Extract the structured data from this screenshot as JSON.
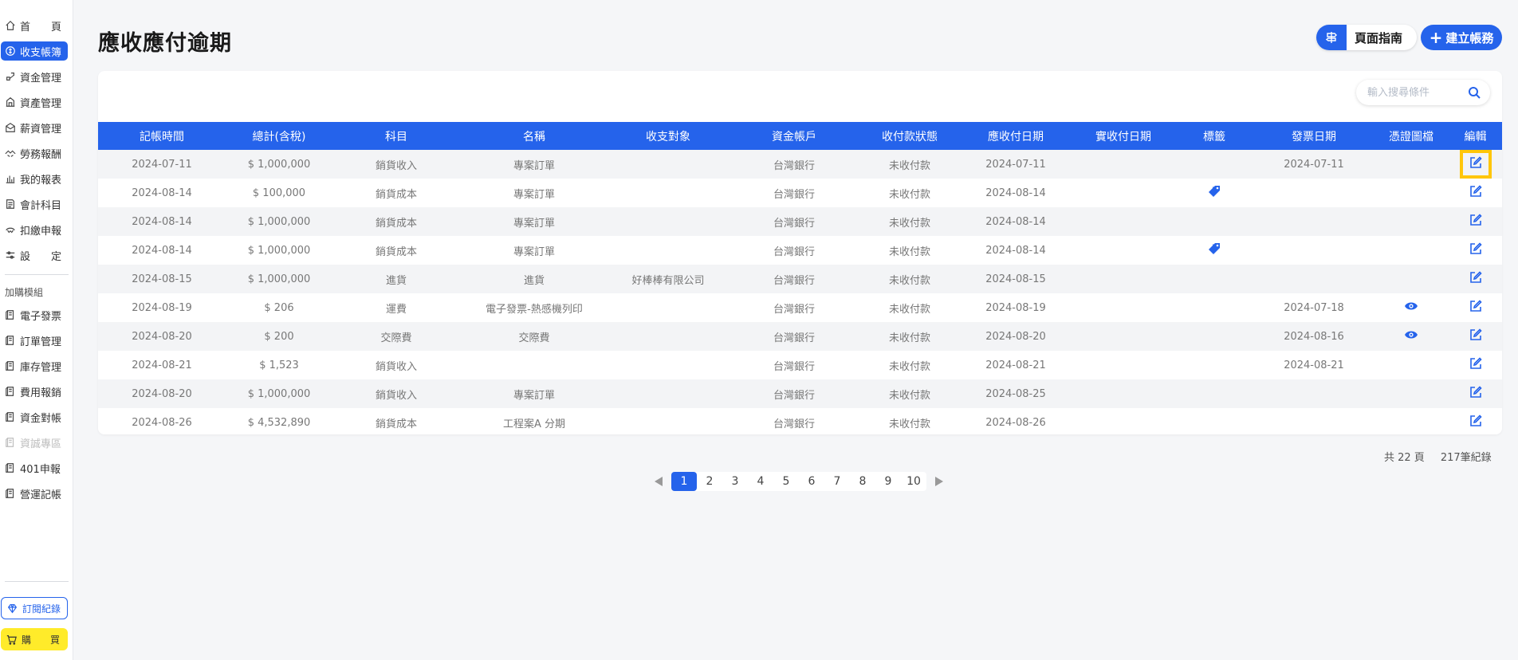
{
  "sidebar": {
    "items": [
      {
        "label": "首　　頁",
        "icon": "home-icon"
      },
      {
        "label": "收支帳簿",
        "icon": "coin-icon",
        "active": true
      },
      {
        "label": "資金管理",
        "icon": "money-bag-icon"
      },
      {
        "label": "資產管理",
        "icon": "building-icon"
      },
      {
        "label": "薪資管理",
        "icon": "envelope-icon"
      },
      {
        "label": "勞務報酬",
        "icon": "handshake-icon"
      },
      {
        "label": "我的報表",
        "icon": "bar-chart-icon"
      },
      {
        "label": "會計科目",
        "icon": "ledger-icon"
      },
      {
        "label": "扣繳申報",
        "icon": "hands-icon"
      },
      {
        "label": "設　　定",
        "icon": "sliders-icon"
      }
    ],
    "addon_label": "加購模組",
    "addon_items": [
      {
        "label": "電子發票",
        "disabled": false
      },
      {
        "label": "訂單管理",
        "disabled": false
      },
      {
        "label": "庫存管理",
        "disabled": false
      },
      {
        "label": "費用報銷",
        "disabled": false
      },
      {
        "label": "資金對帳",
        "disabled": false
      },
      {
        "label": "資誠專區",
        "disabled": true
      },
      {
        "label": "401申報",
        "disabled": false
      },
      {
        "label": "營運記帳",
        "disabled": false
      }
    ],
    "subscription_label": "訂閱紀錄",
    "buy_label": "購　　買"
  },
  "header": {
    "title": "應收應付逾期",
    "guide_label": "頁面指南",
    "create_label": "建立帳務"
  },
  "search": {
    "placeholder": "輸入搜尋條件"
  },
  "table": {
    "columns": [
      "記帳時間",
      "總計(含稅)",
      "科目",
      "名稱",
      "收支對象",
      "資金帳戶",
      "收付款狀態",
      "應收付日期",
      "實收付日期",
      "標籤",
      "發票日期",
      "憑證圖檔",
      "編輯"
    ],
    "rows": [
      {
        "date": "2024-07-11",
        "total": "$ 1,000,000",
        "subject": "銷貨收入",
        "name": "專案訂單",
        "party": "",
        "account": "台灣銀行",
        "status": "未收付款",
        "due": "2024-07-11",
        "actual": "",
        "tag": false,
        "invoice": "2024-07-11",
        "receipt": false,
        "highlight": true
      },
      {
        "date": "2024-08-14",
        "total": "$ 100,000",
        "subject": "銷貨成本",
        "name": "專案訂單",
        "party": "",
        "account": "台灣銀行",
        "status": "未收付款",
        "due": "2024-08-14",
        "actual": "",
        "tag": true,
        "invoice": "",
        "receipt": false,
        "highlight": false
      },
      {
        "date": "2024-08-14",
        "total": "$ 1,000,000",
        "subject": "銷貨成本",
        "name": "專案訂單",
        "party": "",
        "account": "台灣銀行",
        "status": "未收付款",
        "due": "2024-08-14",
        "actual": "",
        "tag": false,
        "invoice": "",
        "receipt": false,
        "highlight": false
      },
      {
        "date": "2024-08-14",
        "total": "$ 1,000,000",
        "subject": "銷貨成本",
        "name": "專案訂單",
        "party": "",
        "account": "台灣銀行",
        "status": "未收付款",
        "due": "2024-08-14",
        "actual": "",
        "tag": true,
        "invoice": "",
        "receipt": false,
        "highlight": false
      },
      {
        "date": "2024-08-15",
        "total": "$ 1,000,000",
        "subject": "進貨",
        "name": "進貨",
        "party": "好棒棒有限公司",
        "account": "台灣銀行",
        "status": "未收付款",
        "due": "2024-08-15",
        "actual": "",
        "tag": false,
        "invoice": "",
        "receipt": false,
        "highlight": false
      },
      {
        "date": "2024-08-19",
        "total": "$ 206",
        "subject": "運費",
        "name": "電子發票-熱感機列印",
        "party": "",
        "account": "台灣銀行",
        "status": "未收付款",
        "due": "2024-08-19",
        "actual": "",
        "tag": false,
        "invoice": "2024-07-18",
        "receipt": true,
        "highlight": false
      },
      {
        "date": "2024-08-20",
        "total": "$ 200",
        "subject": "交際費",
        "name": "交際費",
        "party": "",
        "account": "台灣銀行",
        "status": "未收付款",
        "due": "2024-08-20",
        "actual": "",
        "tag": false,
        "invoice": "2024-08-16",
        "receipt": true,
        "highlight": false
      },
      {
        "date": "2024-08-21",
        "total": "$ 1,523",
        "subject": "銷貨收入",
        "name": "",
        "party": "",
        "account": "台灣銀行",
        "status": "未收付款",
        "due": "2024-08-21",
        "actual": "",
        "tag": false,
        "invoice": "2024-08-21",
        "receipt": false,
        "highlight": false
      },
      {
        "date": "2024-08-20",
        "total": "$ 1,000,000",
        "subject": "銷貨收入",
        "name": "專案訂單",
        "party": "",
        "account": "台灣銀行",
        "status": "未收付款",
        "due": "2024-08-25",
        "actual": "",
        "tag": false,
        "invoice": "",
        "receipt": false,
        "highlight": false
      },
      {
        "date": "2024-08-26",
        "total": "$ 4,532,890",
        "subject": "銷貨成本",
        "name": "工程案A 分期",
        "party": "",
        "account": "台灣銀行",
        "status": "未收付款",
        "due": "2024-08-26",
        "actual": "",
        "tag": false,
        "invoice": "",
        "receipt": false,
        "highlight": false
      }
    ]
  },
  "summary": {
    "pages_text": "共 22 頁",
    "records_text": "217筆紀錄"
  },
  "pagination": {
    "pages": [
      "1",
      "2",
      "3",
      "4",
      "5",
      "6",
      "7",
      "8",
      "9",
      "10"
    ],
    "current": "1"
  },
  "colors": {
    "primary": "#2563eb",
    "highlight": "#ffc60a",
    "buy": "#ffeb2a"
  }
}
